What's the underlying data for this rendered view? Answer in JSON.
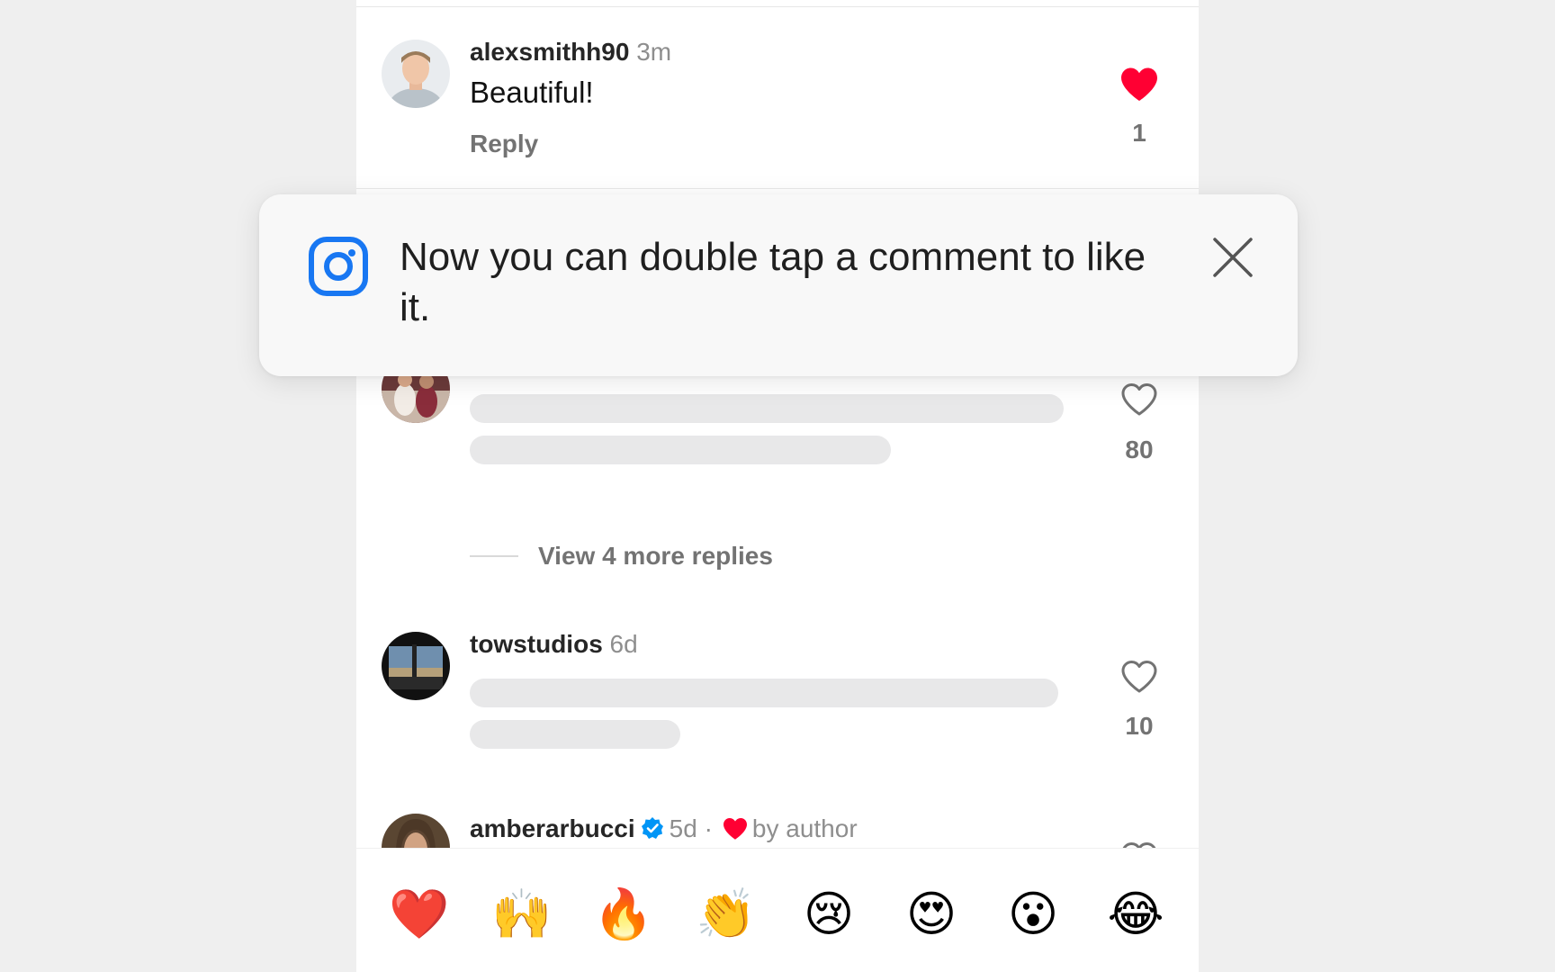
{
  "comments": [
    {
      "username": "alexsmithh90",
      "time": "3m",
      "text": "Beautiful!",
      "reply_label": "Reply",
      "likes": "1",
      "liked": true
    },
    {
      "likes": "80",
      "liked": false
    },
    {
      "username": "towstudios",
      "time": "6d",
      "likes": "10",
      "liked": false
    },
    {
      "username": "amberarbucci",
      "time": "5d",
      "separator": "·",
      "author_like_label": "by author",
      "verified": true
    }
  ],
  "view_replies_label": "View 4 more replies",
  "toast": {
    "message": "Now you can double tap a comment to like it.",
    "icon": "instagram-icon",
    "close_icon": "close-icon"
  },
  "emoji_bar": [
    "❤️",
    "🙌",
    "🔥",
    "👏",
    "😢",
    "😍",
    "😮",
    "😂"
  ],
  "colors": {
    "like_red": "#ff0033",
    "instagram_blue": "#1877f2",
    "verified_blue": "#0095f6",
    "secondary_text": "#737373"
  }
}
